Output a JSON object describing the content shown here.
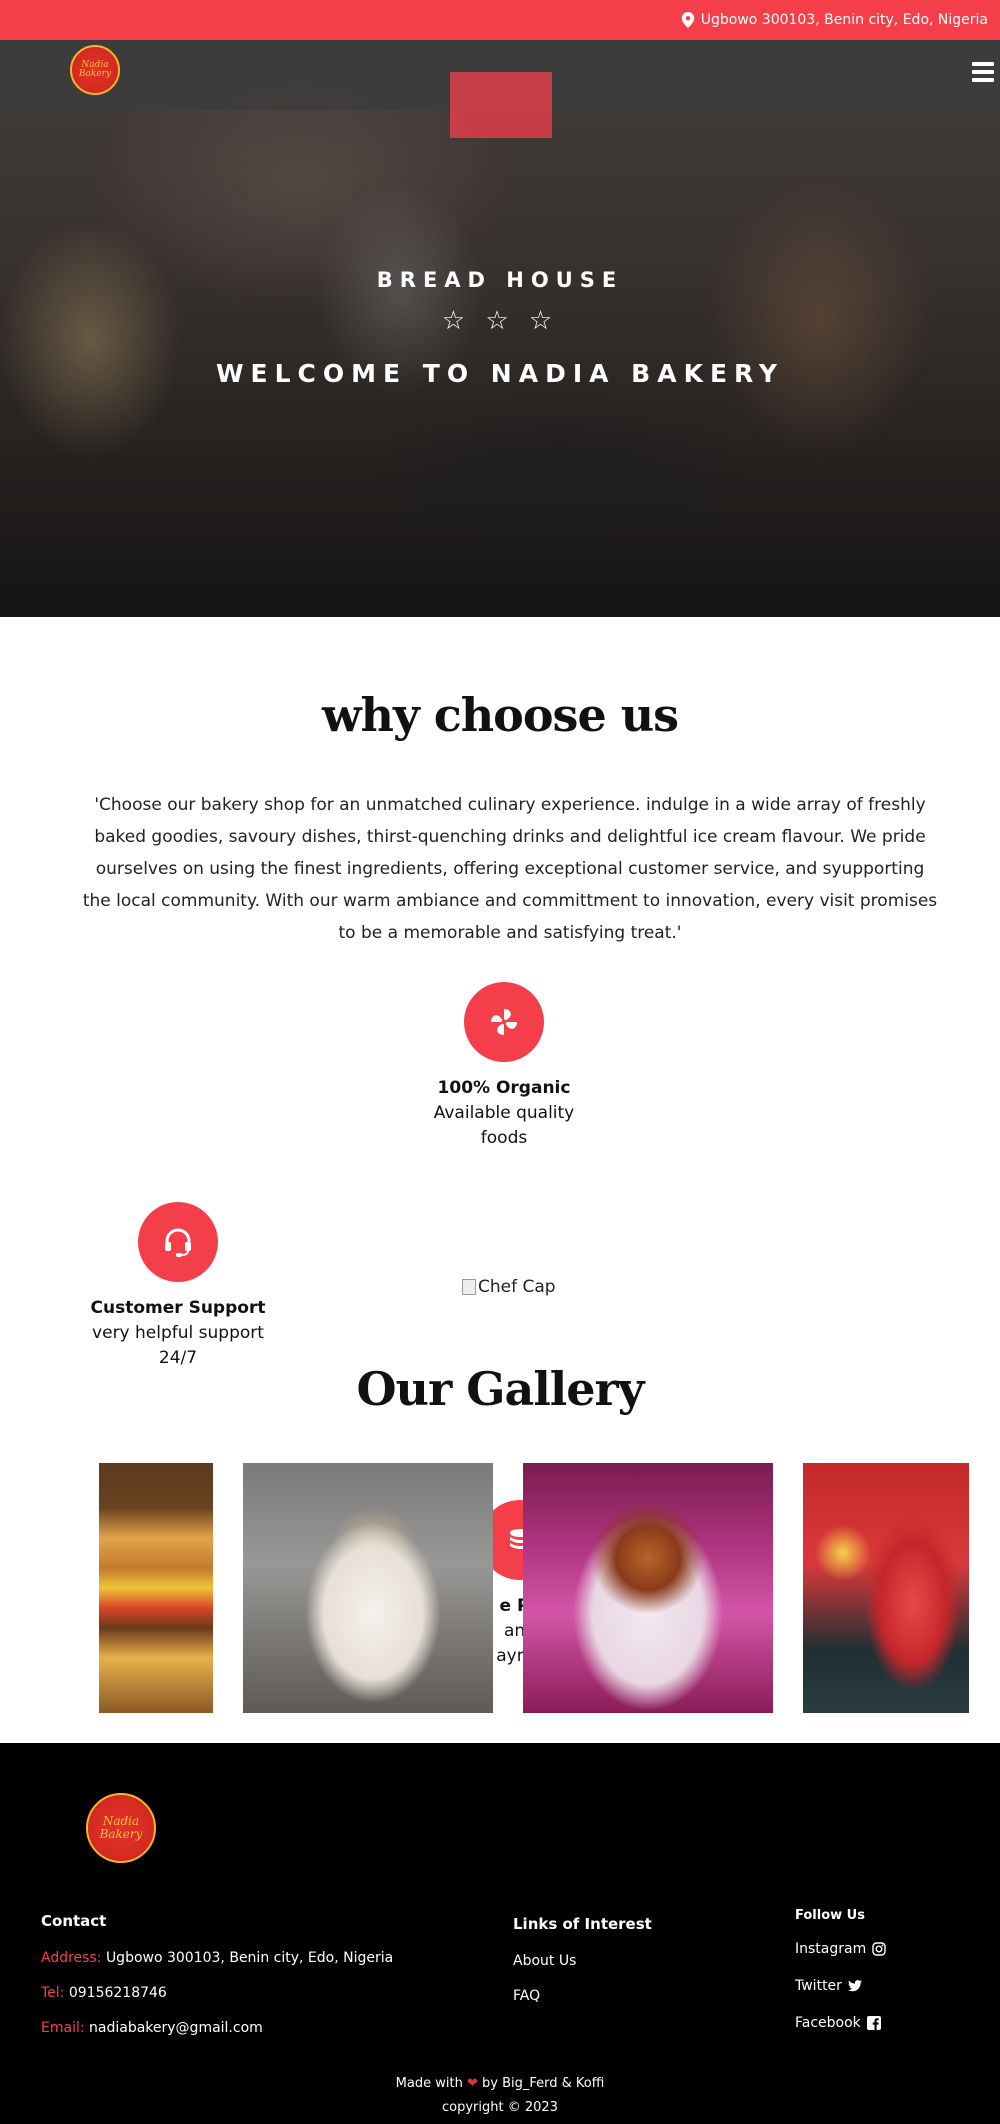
{
  "topbar": {
    "address": "Ugbowo 300103, Benin city, Edo, Nigeria",
    "icon": "map-pin-icon"
  },
  "header": {
    "logo_text": "Nadia Bakery",
    "menu_icon": "hamburger-menu-icon"
  },
  "hero": {
    "subtitle": "BREAD HOUSE",
    "stars": "☆ ☆ ☆",
    "title": "WELCOME TO NADIA BAKERY"
  },
  "why": {
    "title": "why choose us",
    "text": "'Choose our bakery shop for an unmatched culinary experience. indulge in a wide array of freshly baked goodies, savoury dishes, thirst-quenching drinks and delightful ice cream flavour. We pride ourselves on using the finest ingredients, offering exceptional customer service, and syupporting the local community. With our warm ambiance and committment to innovation, every visit promises to be a memorable and satisfying treat.'"
  },
  "features": [
    {
      "title": "100% Organic",
      "desc": "Available quality foods",
      "icon": "pinwheel-icon"
    },
    {
      "title": "Customer Support",
      "desc": "very helpful support 24/7",
      "icon": "headset-icon"
    },
    {
      "title": "e Pa",
      "desc": "and",
      "desc2": "ayme",
      "icon": "coins-icon"
    }
  ],
  "chef_image_alt": "Chef Cap",
  "gallery": {
    "title": "Our Gallery",
    "items": [
      "burger-image",
      "parfait-cups-image",
      "parfait-flowers-image",
      "juice-bottle-image"
    ]
  },
  "footer": {
    "logo_text": "Nadia Bakery",
    "contact": {
      "title": "Contact",
      "address_label": "Address:",
      "address": "Ugbowo 300103, Benin city, Edo, Nigeria",
      "tel_label": "Tel:",
      "tel": "09156218746",
      "email_label": "Email:",
      "email": "nadiabakery@gmail.com"
    },
    "links": {
      "title": "Links of Interest",
      "items": [
        "About Us",
        "FAQ"
      ]
    },
    "follow": {
      "title": "Follow Us",
      "items": [
        "Instagram",
        "Twitter",
        "Facebook"
      ]
    },
    "made_with": "Made with",
    "heart": "❤",
    "made_by": "by Big_Ferd & Koffi",
    "copyright": "copyright © 2023"
  },
  "colors": {
    "accent": "#f43f4b",
    "footer_bg": "#000000"
  }
}
